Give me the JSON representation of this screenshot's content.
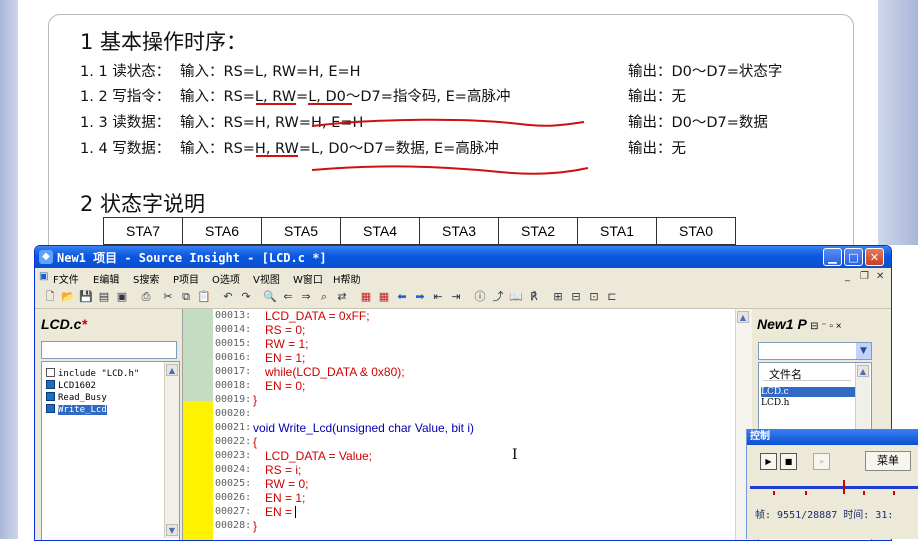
{
  "slide": {
    "section1_title": "1  基本操作时序：",
    "rows": [
      {
        "label": "1. 1 读状态：",
        "input": "输入：RS=L, RW=H, E=H",
        "output": "输出：D0～D7=状态字"
      },
      {
        "label": "1. 2 写指令：",
        "input": "输入：RS=L, RW=L, D0～D7=指令码, E=高脉冲",
        "output": "输出：无"
      },
      {
        "label": "1. 3 读数据：",
        "input": "输入：RS=H, RW=H, E=H",
        "output": "输出：D0～D7=数据"
      },
      {
        "label": "1. 4 写数据：",
        "input": "输入：RS=H, RW=L, D0～D7=数据, E=高脉冲",
        "output": "输出：无"
      }
    ],
    "section2_title": "2  状态字说明",
    "table_headers": [
      "STA7",
      "STA6",
      "STA5",
      "STA4",
      "STA3",
      "STA2",
      "STA1",
      "STA0"
    ],
    "annotation_color": "#d01010"
  },
  "window": {
    "title": "New1 项目 - Source Insight - [LCD.c *]",
    "menus": [
      "F文件",
      "E编辑",
      "S搜索",
      "P项目",
      "O选项",
      "V视图",
      "W窗口",
      "H帮助"
    ],
    "symbol_pane": {
      "title": "LCD.c",
      "modified_mark": "*",
      "items": [
        {
          "icon": "include-icon",
          "text": "include \"LCD.h\""
        },
        {
          "icon": "function-icon",
          "text": "LCD1602"
        },
        {
          "icon": "function-icon",
          "text": "Read_Busy"
        },
        {
          "icon": "function-icon",
          "text": "Write_Lcd",
          "selected": true
        }
      ]
    },
    "editor": {
      "lines": [
        {
          "num": "00013:",
          "text": "LCD_DATA = 0xFF;"
        },
        {
          "num": "00014:",
          "text": "RS = 0;"
        },
        {
          "num": "00015:",
          "text": "RW = 1;"
        },
        {
          "num": "00016:",
          "text": "EN = 1;"
        },
        {
          "num": "00017:",
          "text": "while(LCD_DATA & 0x80);"
        },
        {
          "num": "00018:",
          "text": "EN = 0;"
        },
        {
          "num": "00019:",
          "text": "}"
        },
        {
          "num": "00020:",
          "text": ""
        },
        {
          "num": "00021:",
          "text": "void Write_Lcd(unsigned char Value, bit i)"
        },
        {
          "num": "00022:",
          "text": "{"
        },
        {
          "num": "00023:",
          "text": "LCD_DATA = Value;"
        },
        {
          "num": "00024:",
          "text": "RS = i;"
        },
        {
          "num": "00025:",
          "text": "RW = 0;"
        },
        {
          "num": "00026:",
          "text": "EN = 1;"
        },
        {
          "num": "00027:",
          "text": "EN = "
        },
        {
          "num": "00028:",
          "text": "}"
        }
      ]
    },
    "project_pane": {
      "title": "New1 P",
      "column_header": "文件名",
      "files": [
        {
          "name": "LCD.c",
          "selected": true
        },
        {
          "name": "LCD.h",
          "selected": false
        }
      ]
    }
  },
  "control": {
    "title": "控制",
    "menu_button": "菜单",
    "status": "帧: 9551/28887 时间: 31:",
    "progress": 0.55
  }
}
